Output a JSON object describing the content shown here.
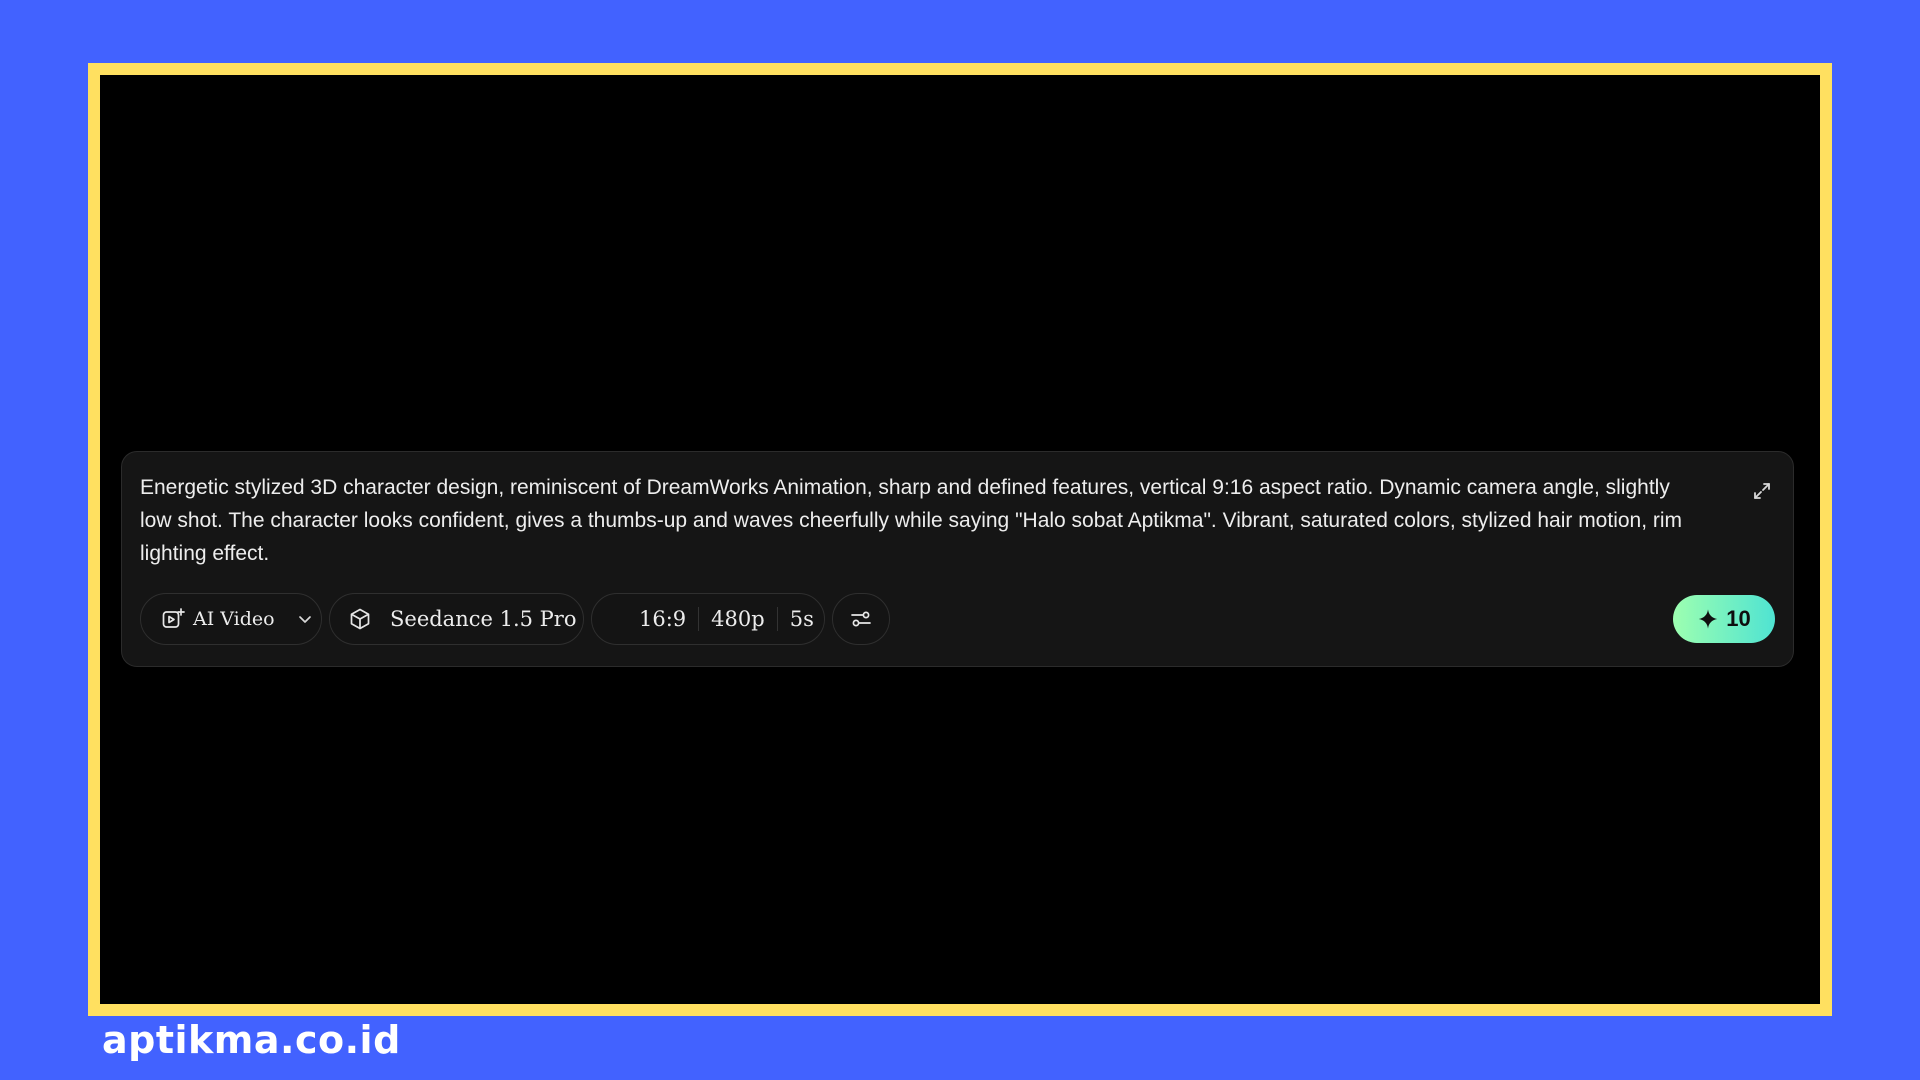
{
  "prompt": {
    "text": "Energetic stylized 3D character design, reminiscent of DreamWorks Animation, sharp and defined features, vertical 9:16 aspect ratio. Dynamic camera angle, slightly low shot. The character looks confident, gives a thumbs-up and waves cheerfully while saying \"Halo sobat Aptikma\". Vibrant, saturated colors, stylized hair motion, rim lighting effect.",
    "expand_icon": "expand-arrows-icon"
  },
  "toolbar": {
    "mode_label": "AI Video",
    "mode_icon": "video-add-icon",
    "model_label": "Seedance 1.5 Pro",
    "model_icon": "cube-icon",
    "aspect_ratio": "16:9",
    "resolution": "480p",
    "duration": "5s",
    "settings_icon": "sliders-icon"
  },
  "generate": {
    "credits": "10",
    "icon": "sparkle-icon"
  },
  "watermark": "aptikma.co.id",
  "colors": {
    "background": "#4262ff",
    "frame_border": "#ffe060",
    "panel": "#151515",
    "generate_gradient_start": "#9dffb0",
    "generate_gradient_end": "#4fe3d2"
  }
}
